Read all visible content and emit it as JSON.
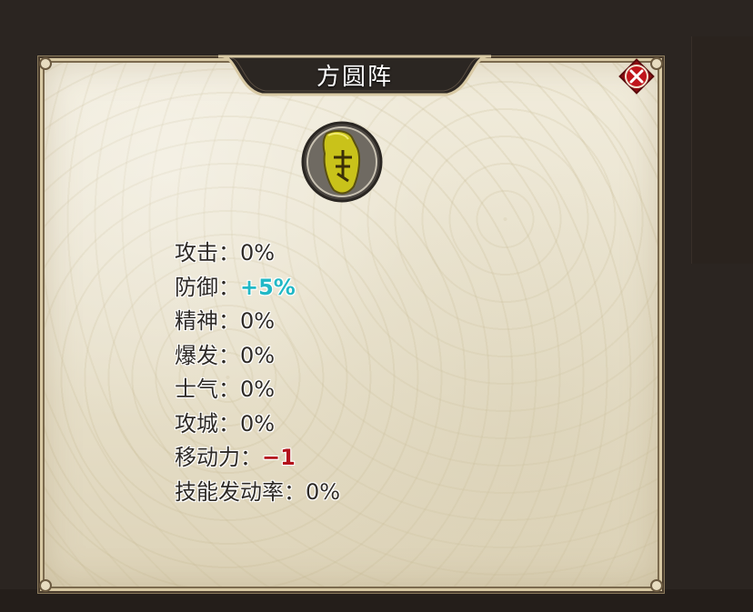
{
  "dialog": {
    "title": "方圆阵"
  },
  "icons": {
    "close": "close-icon",
    "formation": "formation-scroll-icon"
  },
  "stats": [
    {
      "label": "攻击：",
      "value": "0%",
      "tone": "neutral"
    },
    {
      "label": "防御：",
      "value": "+5%",
      "tone": "positive"
    },
    {
      "label": "精神：",
      "value": "0%",
      "tone": "neutral"
    },
    {
      "label": "爆发：",
      "value": "0%",
      "tone": "neutral"
    },
    {
      "label": "士气：",
      "value": "0%",
      "tone": "neutral"
    },
    {
      "label": "攻城：",
      "value": "0%",
      "tone": "neutral"
    },
    {
      "label": "移动力：",
      "value": "−1",
      "tone": "negative"
    },
    {
      "label": "技能发动率：",
      "value": "0%",
      "tone": "neutral"
    }
  ],
  "colors": {
    "positive": "#21b8c6",
    "negative": "#b3121b",
    "close_red": "#c0161c"
  }
}
